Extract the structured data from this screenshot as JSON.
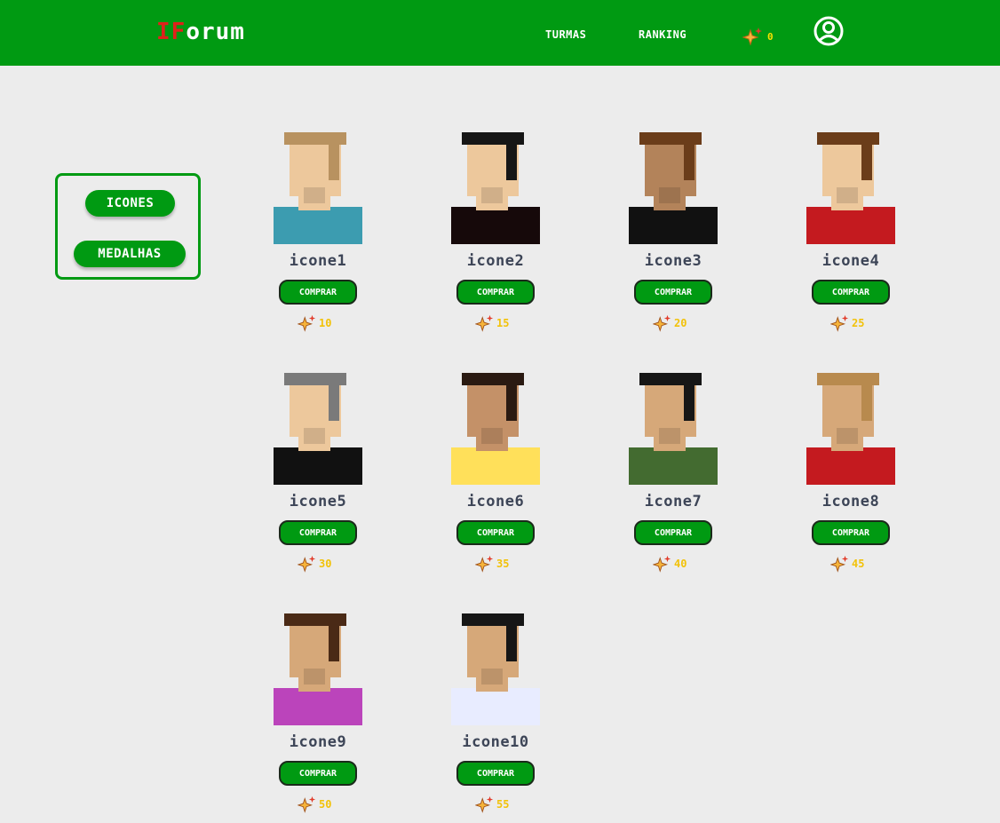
{
  "header": {
    "logo_part1": "IF",
    "logo_part2": "orum",
    "nav": [
      "TURMAS",
      "RANKING"
    ],
    "balance": "0",
    "balance_icon": "sparkle-icon",
    "profile_icon": "user-circle-icon",
    "bg_color": "#009a12"
  },
  "sidebar": {
    "buttons": [
      "ICONES",
      "MEDALHAS"
    ],
    "accent": "#009a12"
  },
  "shop": {
    "buy_label": "COMPRAR",
    "price_icon": "sparkle-icon",
    "items": [
      {
        "name": "icone1",
        "price": "10",
        "shirt": "#3c9cb0",
        "hair": "#b89260",
        "skin": "#edc89c"
      },
      {
        "name": "icone2",
        "price": "15",
        "shirt": "#16090a",
        "hair": "#161616",
        "skin": "#edc89c"
      },
      {
        "name": "icone3",
        "price": "20",
        "shirt": "#111111",
        "hair": "#6b3d1a",
        "skin": "#b3835a"
      },
      {
        "name": "icone4",
        "price": "25",
        "shirt": "#c41a1f",
        "hair": "#6b3d1a",
        "skin": "#edc89c"
      },
      {
        "name": "icone5",
        "price": "30",
        "shirt": "#111111",
        "hair": "#7a7a7a",
        "skin": "#edc89c"
      },
      {
        "name": "icone6",
        "price": "35",
        "shirt": "#ffe05a",
        "hair": "#2a1a12",
        "skin": "#c49168"
      },
      {
        "name": "icone7",
        "price": "40",
        "shirt": "#436b30",
        "hair": "#161616",
        "skin": "#d6a879"
      },
      {
        "name": "icone8",
        "price": "45",
        "shirt": "#c41a1f",
        "hair": "#b88a4e",
        "skin": "#d6a879"
      },
      {
        "name": "icone9",
        "price": "50",
        "shirt": "#bb44bb",
        "hair": "#4a2a16",
        "skin": "#d6a879"
      },
      {
        "name": "icone10",
        "price": "55",
        "shirt": "#e8ecff",
        "hair": "#161616",
        "skin": "#d6a879"
      }
    ]
  }
}
